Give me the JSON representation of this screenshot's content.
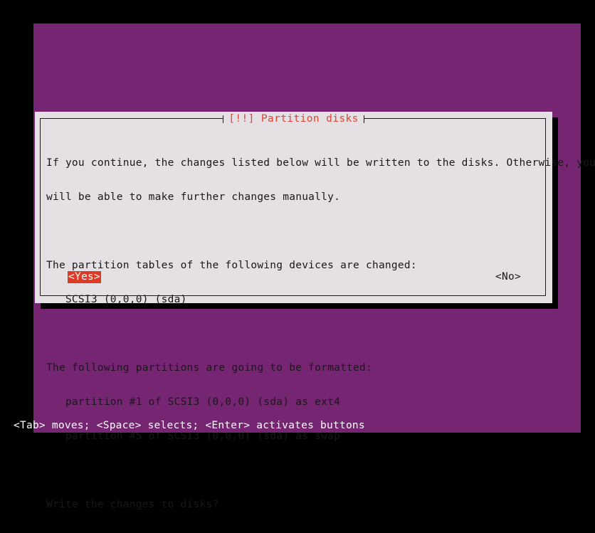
{
  "screen": {
    "background_color": "#000000",
    "desktop_color": "#762572"
  },
  "dialog": {
    "title": "[!!] Partition disks",
    "title_color": "#dd4433",
    "background_color": "#e4e0e4",
    "border_color": "#1a1a1a",
    "lines": [
      "If you continue, the changes listed below will be written to the disks. Otherwise, you",
      "will be able to make further changes manually.",
      "",
      "The partition tables of the following devices are changed:",
      "   SCSI3 (0,0,0) (sda)",
      "",
      "The following partitions are going to be formatted:",
      "   partition #1 of SCSI3 (0,0,0) (sda) as ext4",
      "   partition #5 of SCSI3 (0,0,0) (sda) as swap",
      "",
      "Write the changes to disks?"
    ],
    "buttons": [
      {
        "label": "<Yes>",
        "selected": true,
        "selected_bg": "#dd3b26",
        "selected_fg": "#ffffff"
      },
      {
        "label": "<No>",
        "selected": false,
        "selected_bg": "",
        "selected_fg": ""
      }
    ]
  },
  "statusbar": {
    "text": "<Tab> moves; <Space> selects; <Enter> activates buttons",
    "background_color": "#762572",
    "text_color": "#ffffff"
  }
}
